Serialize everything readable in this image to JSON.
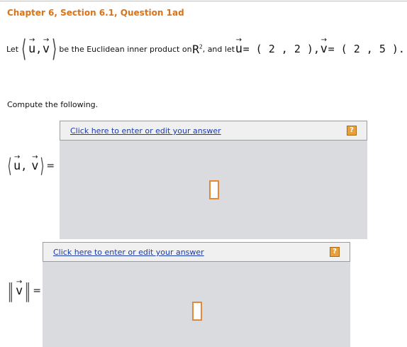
{
  "title": "Chapter 6, Section 6.1, Question 1ad",
  "problem": {
    "let": "Let",
    "u_symbol": "u",
    "comma": ",",
    "v_symbol": "v",
    "text1": "be the Euclidean inner product on",
    "space": "R",
    "exponent": "2",
    "text2": ", and let",
    "u_value": "= ( 2 , 2 ),",
    "v_value": "= ( 2 , 5 )."
  },
  "compute_label": "Compute the following.",
  "parts": [
    {
      "link": "Click here to enter or edit your answer",
      "help": "?",
      "equals": "="
    },
    {
      "link": "Click here to enter or edit your answer",
      "help": "?",
      "equals": "="
    }
  ],
  "colors": {
    "title": "#d9731a",
    "link": "#1c3aa8",
    "panel": "#d9dbde",
    "help": "#e7a03a"
  },
  "icons": [
    "help-icon",
    "vector-arrow-icon"
  ]
}
